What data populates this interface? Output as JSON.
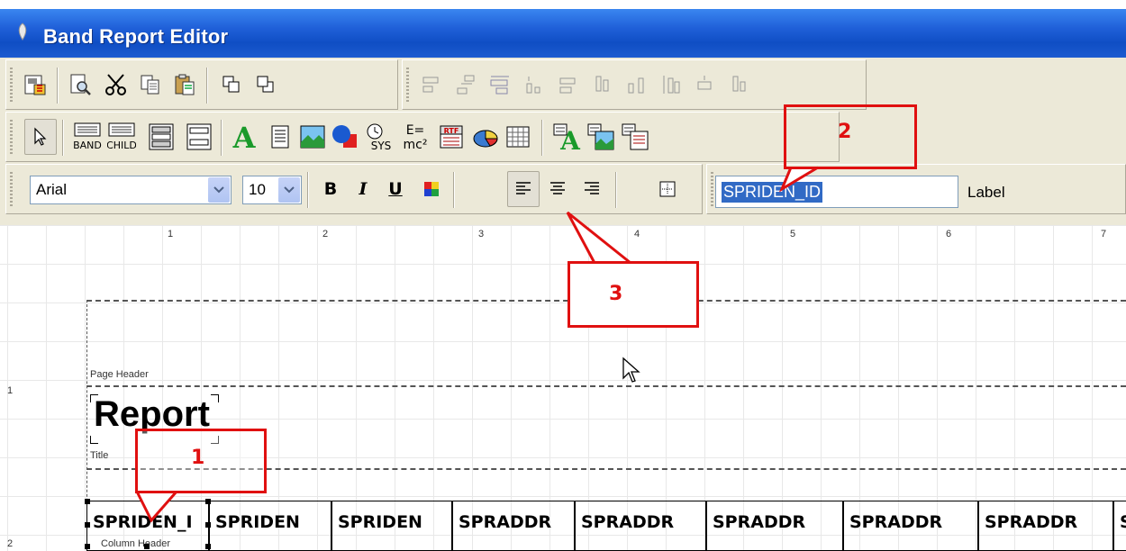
{
  "window": {
    "title": "Band Report Editor"
  },
  "font_toolbar": {
    "font_name": "Arial",
    "font_size": "10",
    "bold_glyph": "B",
    "italic_glyph": "I",
    "underline_glyph": "U"
  },
  "name_field": {
    "value": "SPRIDEN_ID"
  },
  "label_field": {
    "text": "Label"
  },
  "band_buttons": {
    "band": "BAND",
    "child": "CHILD"
  },
  "formula_button": {
    "top": "E=",
    "bottom": "mc²"
  },
  "sys_button": {
    "text": "SYS"
  },
  "rtf_button": {
    "text": "RTF"
  },
  "ruler": {
    "h": [
      "1",
      "2",
      "3",
      "4",
      "5",
      "6",
      "7"
    ],
    "v": [
      "1",
      "2"
    ]
  },
  "bands": {
    "page_header": "Page Header",
    "title": "Title",
    "column_header": "Column Header"
  },
  "title_band": {
    "report_text": "Report"
  },
  "column_header_cells": [
    "SPRIDEN_I",
    "SPRIDEN",
    "SPRIDEN",
    "SPRADDR",
    "SPRADDR",
    "SPRADDR",
    "SPRADDR",
    "SPRADDR",
    "S"
  ],
  "callouts": [
    "1",
    "2",
    "3"
  ],
  "colors": {
    "title_bar": "#1f5fd8",
    "toolbar_bg": "#ece9d8",
    "selection": "#316ac5",
    "callout": "#e01010"
  }
}
